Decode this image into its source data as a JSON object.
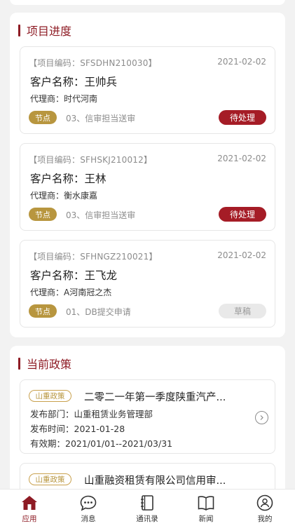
{
  "progress": {
    "title": "项目进度",
    "items": [
      {
        "code": "【项目编码：SFSDHN210030】",
        "date": "2021-02-02",
        "customer": "客户名称：王帅兵",
        "agent": "代理商：时代河南",
        "node_label": "节点",
        "step": "03、信审担当送审",
        "status": "待处理"
      },
      {
        "code": "【项目编码：SFHSKJ210012】",
        "date": "2021-02-02",
        "customer": "客户名称：王林",
        "agent": "代理商：衡水康嘉",
        "node_label": "节点",
        "step": "03、信审担当送审",
        "status": "待处理"
      },
      {
        "code": "【项目编码：SFHNGZ210021】",
        "date": "2021-02-02",
        "customer": "客户名称：王飞龙",
        "agent": "代理商：A河南冠之杰",
        "node_label": "节点",
        "step": "01、DB提交申请",
        "status": "草稿"
      }
    ]
  },
  "policy": {
    "title": "当前政策",
    "items": [
      {
        "tag": "山重政策",
        "title": "二零二一年第一季度陕重汽产...",
        "department": "发布部门：山重租赁业务管理部",
        "publish_time": "发布时间：2021-01-28",
        "validity": "有效期：2021/01/01--2021/03/31",
        "arrow_icon": "chevron-right-circle-icon"
      },
      {
        "tag": "山重政策",
        "title": "山重融资租赁有限公司信用审..."
      }
    ]
  },
  "tabbar": {
    "items": [
      {
        "label": "应用",
        "icon": "home-icon",
        "active": true
      },
      {
        "label": "消息",
        "icon": "chat-bubble-icon",
        "active": false
      },
      {
        "label": "通讯录",
        "icon": "address-book-icon",
        "active": false
      },
      {
        "label": "新闻",
        "icon": "open-book-icon",
        "active": false
      },
      {
        "label": "我的",
        "icon": "user-icon",
        "active": false
      }
    ]
  },
  "colors": {
    "brand": "#8e1b24",
    "status_pending": "#a51c26",
    "node_gold": "#b8963f",
    "background": "#f2f2f2"
  }
}
